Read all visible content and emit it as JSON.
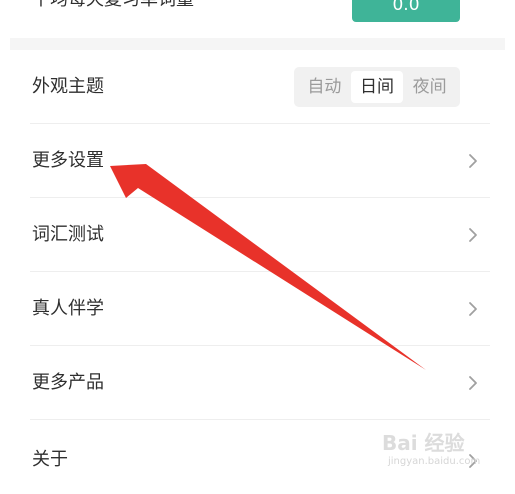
{
  "top_row": {
    "label": "平均每天复习单词量",
    "value": "0.0"
  },
  "settings": {
    "theme": {
      "label": "外观主题",
      "options": [
        "自动",
        "日间",
        "夜间"
      ],
      "selected": "日间"
    },
    "items": [
      {
        "label": "更多设置"
      },
      {
        "label": "词汇测试"
      },
      {
        "label": "真人伴学"
      },
      {
        "label": "更多产品"
      },
      {
        "label": "关于"
      }
    ]
  },
  "annotation": {
    "arrow_color": "#e8322a"
  },
  "watermark": {
    "logo_text": "Bai 经验",
    "sub_text": "jingyan.baidu.com"
  },
  "colors": {
    "accent": "#3fb498",
    "chevron": "#a0a0a0",
    "divider": "#eeeeee"
  }
}
